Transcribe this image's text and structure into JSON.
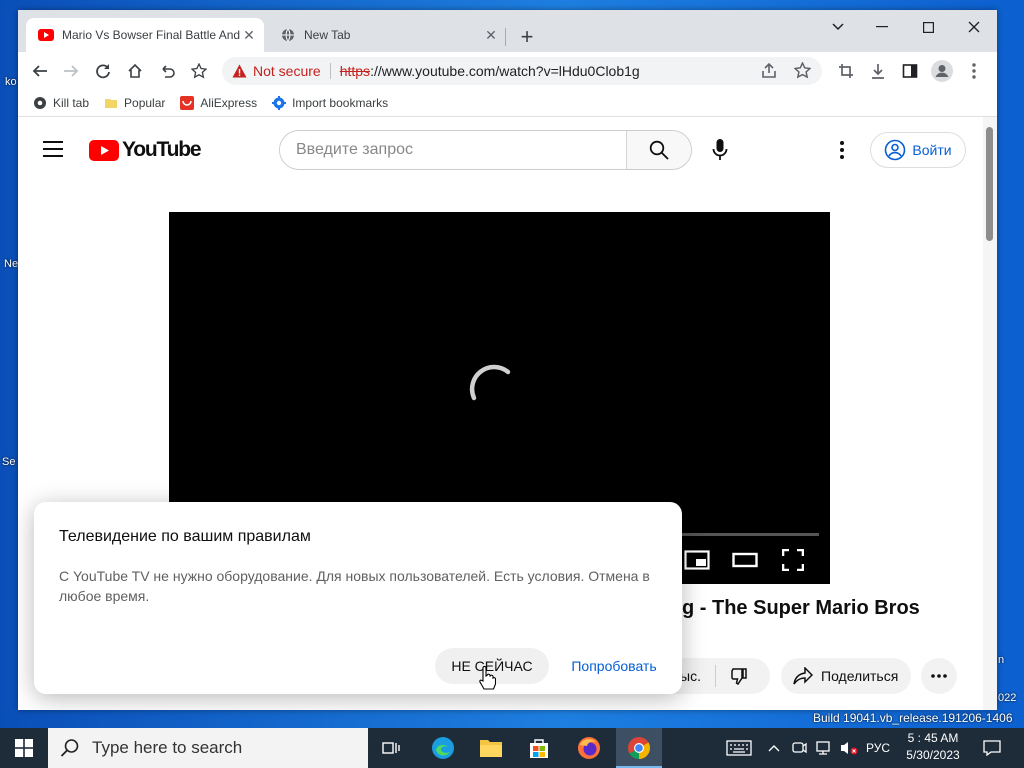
{
  "browser": {
    "tabs": [
      {
        "label": "Mario Vs Bowser Final Battle And",
        "active": true
      },
      {
        "label": "New Tab",
        "active": false
      }
    ],
    "omnibox": {
      "security_label": "Not secure",
      "url_scheme": "https",
      "url_rest": "://www.youtube.com/watch?v=lHdu0Clob1g"
    },
    "bookmarks": [
      {
        "label": "Kill tab",
        "icon": "gear-icon"
      },
      {
        "label": "Popular",
        "icon": "folder-icon"
      },
      {
        "label": "AliExpress",
        "icon": "aliexpress-icon"
      },
      {
        "label": "Import bookmarks",
        "icon": "gear-icon"
      }
    ]
  },
  "youtube": {
    "logo_text": "YouTube",
    "search_placeholder": "Введите запрос",
    "signin_label": "Войти",
    "video_title_visible": "g - The Super Mario Bros",
    "like_count_partial": "ыс.",
    "share_label": "Поделиться"
  },
  "dialog": {
    "title": "Телевидение по вашим правилам",
    "body": "С YouTube TV не нужно оборудование. Для новых пользователей. Есть условия. Отмена в любое время.",
    "dismiss_label": "НЕ СЕЙЧАС",
    "accept_label": "Попробовать"
  },
  "taskbar": {
    "search_placeholder": "Type here to search",
    "language": "РУС",
    "time": "5 : 45 AM",
    "date": "5/30/2023"
  },
  "desktop": {
    "build_text": "Build 19041.vb_release.191206-1406",
    "edge_labels": [
      "ko",
      "Ne",
      "Se"
    ],
    "right_edge_labels": [
      "n",
      "022"
    ]
  },
  "colors": {
    "youtube_red": "#ff0000",
    "link_blue": "#065fd4",
    "not_secure_red": "#c5221f",
    "taskbar": "#1e2c3a"
  }
}
